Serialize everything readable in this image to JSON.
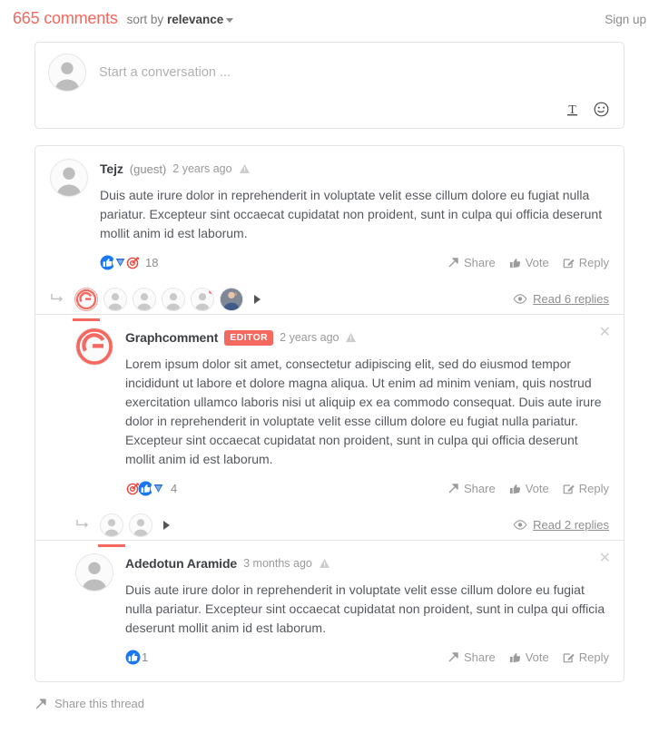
{
  "header": {
    "count_label": "665 comments",
    "sort_prefix": "sort by",
    "sort_value": "relevance",
    "signup_label": "Sign up",
    "accent_color": "#f4685f"
  },
  "compose": {
    "placeholder": "Start a conversation ...",
    "tools": [
      {
        "name": "text-format-icon",
        "glyph": "T"
      },
      {
        "name": "emoji-icon",
        "glyph": "smiley"
      }
    ]
  },
  "actions": {
    "share_label": "Share",
    "vote_label": "Vote",
    "reply_label": "Reply"
  },
  "comments": [
    {
      "author": "Tejz",
      "guest_label": "(guest)",
      "time": "2 years ago",
      "badge": "",
      "text": "Duis aute irure dolor in reprehenderit in voluptate velit esse cillum dolore eu fugiat nulla pariatur. Excepteur sint occaecat cupidatat non proident, sunt in culpa qui officia deserunt mollit anim id est laborum.",
      "reaction_count": "18",
      "reaction_colors": [
        "#1877f2",
        "#2d6fd4",
        "#e8453c"
      ],
      "replies_label": "Read 6 replies",
      "reply_avatars": 6
    },
    {
      "author": "Graphcomment",
      "guest_label": "",
      "time": "2 years ago",
      "badge": "EDITOR",
      "text": "Lorem ipsum dolor sit amet, consectetur adipiscing elit, sed do eiusmod tempor incididunt ut labore et dolore magna aliqua. Ut enim ad minim veniam, quis nostrud exercitation ullamco laboris nisi ut aliquip ex ea commodo consequat. Duis aute irure dolor in reprehenderit in voluptate velit esse cillum dolore eu fugiat nulla pariatur. Excepteur sint occaecat cupidatat non proident, sunt in culpa qui officia deserunt mollit anim id est laborum.",
      "reaction_count": "4",
      "reaction_colors": [
        "#e8453c",
        "#1877f2",
        "#2d6fd4"
      ],
      "replies_label": "Read 2 replies",
      "reply_avatars": 2
    },
    {
      "author": "Adedotun Aramide",
      "guest_label": "",
      "time": "3 months ago",
      "badge": "",
      "text": "Duis aute irure dolor in reprehenderit in voluptate velit esse cillum dolore eu fugiat nulla pariatur. Excepteur sint occaecat cupidatat non proident, sunt in culpa qui officia deserunt mollit anim id est laborum.",
      "reaction_count": "1",
      "reaction_colors": [
        "#1877f2"
      ],
      "replies_label": "",
      "reply_avatars": 0
    }
  ],
  "footer": {
    "share_thread_label": "Share this thread"
  }
}
